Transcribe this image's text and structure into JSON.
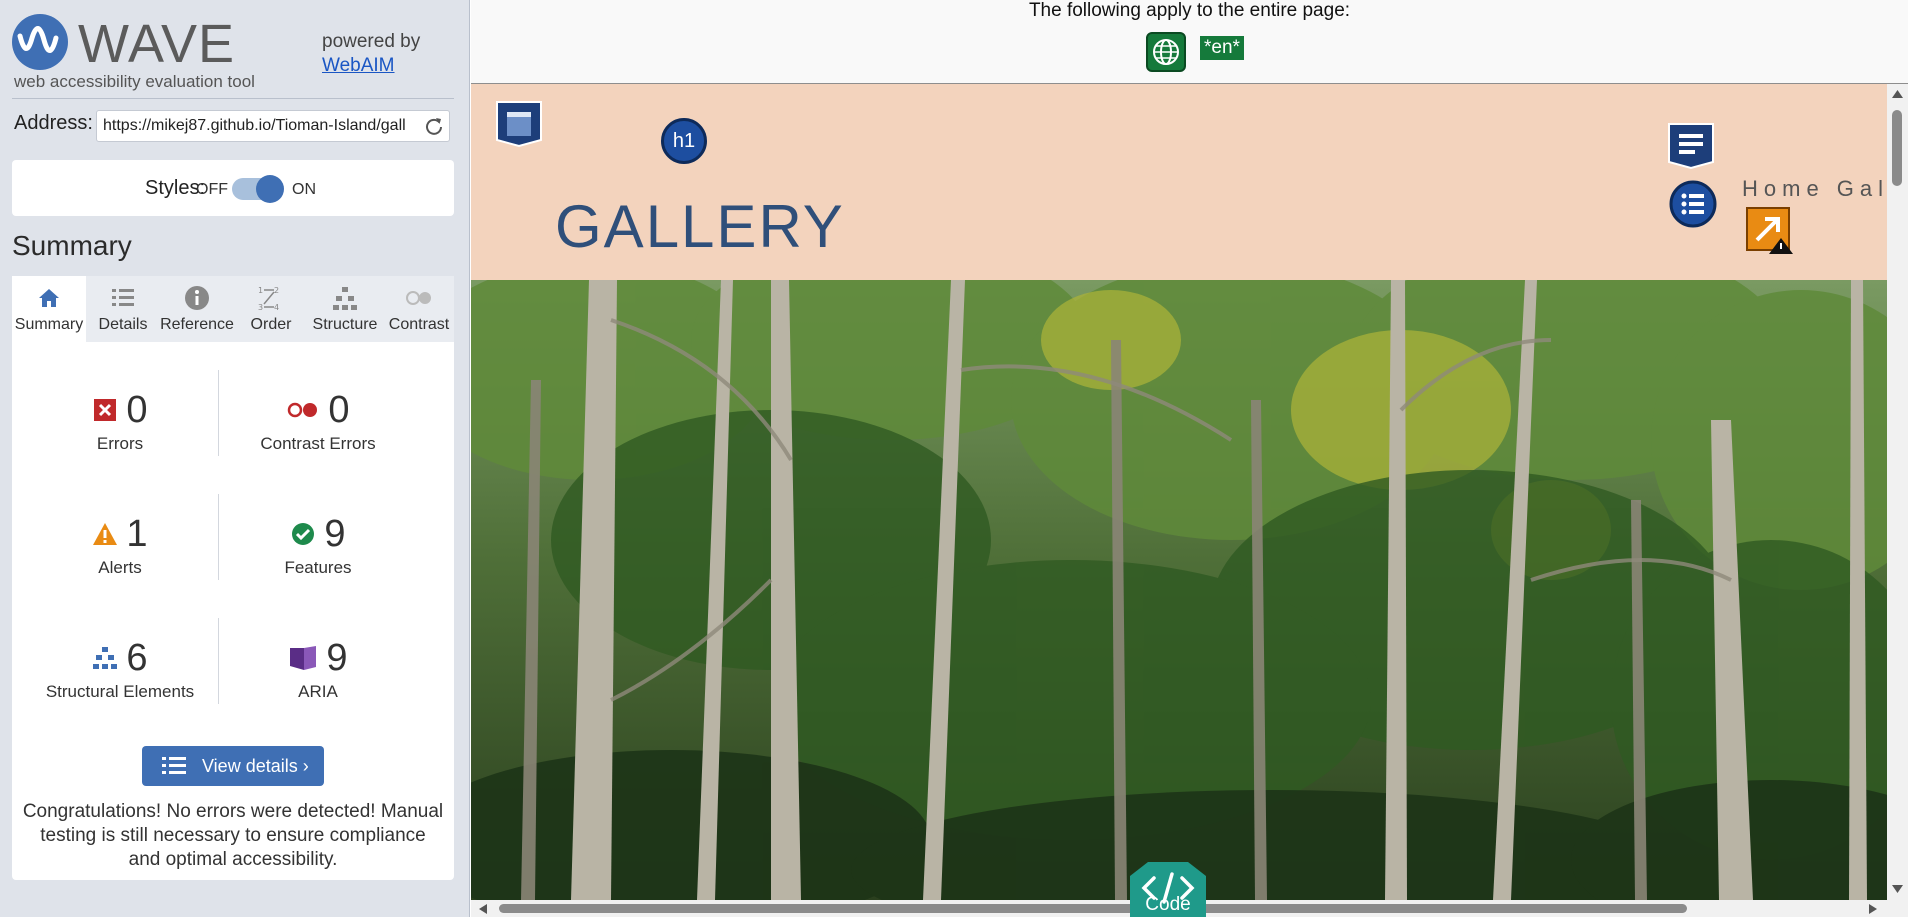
{
  "wave": {
    "logo_word": "WAVE",
    "tagline": "web accessibility evaluation tool",
    "powered_by": "powered by",
    "webaim_link": "WebAIM",
    "address_label": "Address:",
    "address_value": "https://mikej87.github.io/Tioman-Island/gall",
    "styles_label": "Styles:",
    "styles_off": "OFF",
    "styles_on": "ON",
    "summary_title": "Summary",
    "tabs": [
      {
        "label": "Summary",
        "icon": "home-icon"
      },
      {
        "label": "Details",
        "icon": "list-icon"
      },
      {
        "label": "Reference",
        "icon": "info-icon"
      },
      {
        "label": "Order",
        "icon": "order-icon"
      },
      {
        "label": "Structure",
        "icon": "structure-icon"
      },
      {
        "label": "Contrast",
        "icon": "contrast-icon"
      }
    ],
    "metrics": {
      "errors": {
        "value": "0",
        "label": "Errors"
      },
      "contrast": {
        "value": "0",
        "label": "Contrast Errors"
      },
      "alerts": {
        "value": "1",
        "label": "Alerts"
      },
      "features": {
        "value": "9",
        "label": "Features"
      },
      "structural": {
        "value": "6",
        "label": "Structural Elements"
      },
      "aria": {
        "value": "9",
        "label": "ARIA"
      }
    },
    "view_details": "View details ›",
    "congrats": "Congratulations! No errors were detected! Manual testing is still necessary to ensure compliance and optimal accessibility."
  },
  "page": {
    "note": "The following apply to the entire page:",
    "lang_badge": "*en*",
    "h1_badge": "h1",
    "gallery_title": "GALLERY",
    "nav_text": "Home  Gal",
    "code_label": "Code"
  },
  "colors": {
    "wave_blue": "#3f6fb4",
    "error_red": "#c0292b",
    "alert_orange": "#e98b13",
    "feature_green": "#1e8a4c",
    "aria_purple": "#5a2d86",
    "header_peach": "#f3d3bd",
    "title_blue": "#2f4f7a"
  }
}
